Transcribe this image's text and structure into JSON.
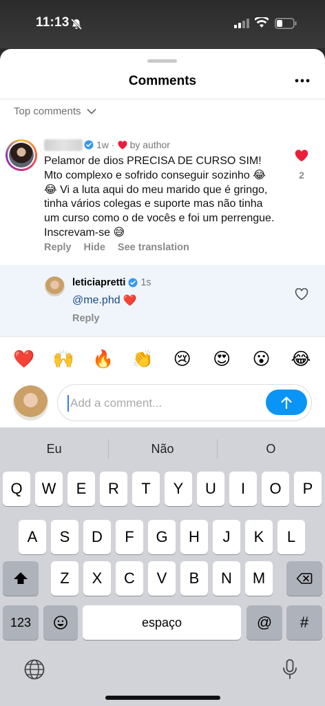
{
  "status_bar": {
    "time": "11:13"
  },
  "sheet": {
    "title": "Comments",
    "sort_label": "Top comments"
  },
  "comment": {
    "time": "1w",
    "liked_by": "by author",
    "text": "Pelamor de dios PRECISA DE CURSO SIM! Mto complexo e sofrido conseguir sozinho 😂😂 Vi a luta aqui do meu marido que é gringo, tinha vários colegas e suporte mas não tinha um curso como o de vocês e foi um perrengue. Inscrevam-se 😅",
    "actions": {
      "reply": "Reply",
      "hide": "Hide",
      "translate": "See translation"
    },
    "like_count": "2"
  },
  "reply": {
    "username": "leticiapretti",
    "time": "1s",
    "mention": "@me.phd",
    "emoji": "❤️",
    "action": "Reply"
  },
  "emoji_bar": [
    "❤️",
    "🙌",
    "🔥",
    "👏",
    "😢",
    "😍",
    "😮",
    "😂"
  ],
  "composer": {
    "placeholder": "Add a comment..."
  },
  "keyboard": {
    "suggestions": [
      "Eu",
      "Não",
      "O"
    ],
    "row1": [
      "Q",
      "W",
      "E",
      "R",
      "T",
      "Y",
      "U",
      "I",
      "O",
      "P"
    ],
    "row2": [
      "A",
      "S",
      "D",
      "F",
      "G",
      "H",
      "J",
      "K",
      "L"
    ],
    "row3": [
      "Z",
      "X",
      "C",
      "V",
      "B",
      "N",
      "M"
    ],
    "num_key": "123",
    "space": "espaço",
    "at": "@",
    "hash": "#"
  },
  "colors": {
    "accent_blue": "#0a95f6",
    "heart_red": "#ed1c3a",
    "verified_blue": "#3897f0"
  }
}
